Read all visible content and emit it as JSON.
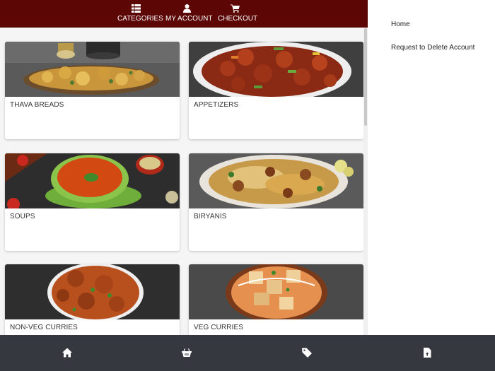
{
  "top_nav": {
    "items": [
      {
        "label": "CATEGORIES",
        "icon": "categories-grid-icon"
      },
      {
        "label": "MY ACCOUNT",
        "icon": "user-icon"
      },
      {
        "label": "CHECKOUT",
        "icon": "cart-icon"
      }
    ],
    "background": "#5c0606"
  },
  "categories": [
    {
      "title": "THAVA BREADS"
    },
    {
      "title": "APPETIZERS"
    },
    {
      "title": "SOUPS"
    },
    {
      "title": "BIRYANIS"
    },
    {
      "title": "NON-VEG CURRIES"
    },
    {
      "title": "VEG CURRIES"
    }
  ],
  "drawer": {
    "links": [
      {
        "label": "Home"
      },
      {
        "label": "Request to Delete Account"
      }
    ]
  },
  "bottom_bar": {
    "buttons": [
      {
        "icon": "home-icon"
      },
      {
        "icon": "basket-icon"
      },
      {
        "icon": "tag-icon"
      },
      {
        "icon": "document-icon"
      }
    ],
    "background": "#35393f"
  }
}
